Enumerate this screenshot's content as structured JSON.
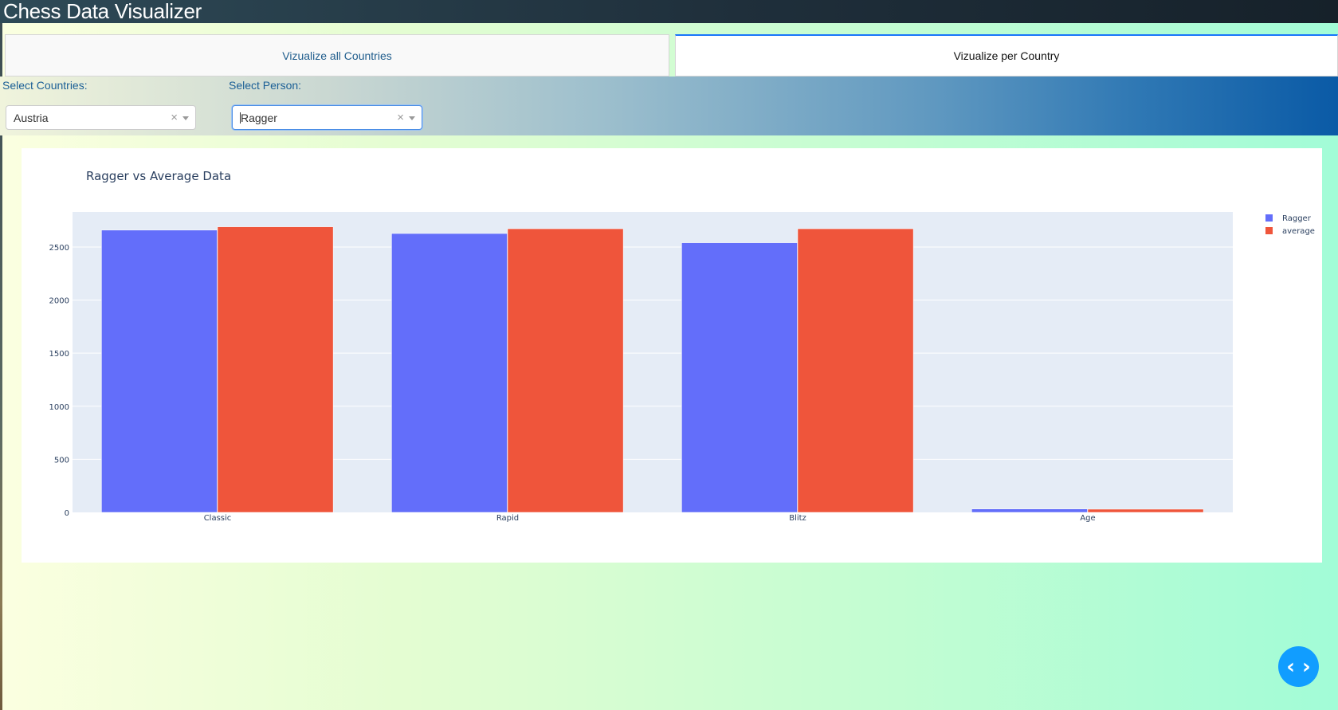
{
  "app": {
    "title": "Chess Data Visualizer"
  },
  "tabs": [
    {
      "label": "Vizualize all Countries",
      "active": false
    },
    {
      "label": "Vizualize per Country",
      "active": true
    }
  ],
  "controls": {
    "countries_label": "Select Countries:",
    "person_label": "Select Person:",
    "country_value": "Austria",
    "person_value": "Ragger",
    "clear_glyph": "×"
  },
  "code_button": {
    "glyph": "‹ ›",
    "icon": "code-icon"
  },
  "colors": {
    "series1": "#636efa",
    "series2": "#ef553b",
    "plot_bg": "#e5ecf6"
  },
  "chart_data": {
    "type": "bar",
    "title": "Ragger vs  Average Data",
    "categories": [
      "Classic",
      "Rapid",
      "Blitz",
      "Age"
    ],
    "series": [
      {
        "name": "Ragger",
        "values": [
          2659,
          2627,
          2540,
          32
        ]
      },
      {
        "name": "average",
        "values": [
          2690,
          2672,
          2672,
          30
        ]
      }
    ],
    "yticks": [
      0,
      500,
      1000,
      1500,
      2000,
      2500
    ],
    "ylim": [
      0,
      2830
    ],
    "legend_position": "top-right",
    "grid": true
  }
}
